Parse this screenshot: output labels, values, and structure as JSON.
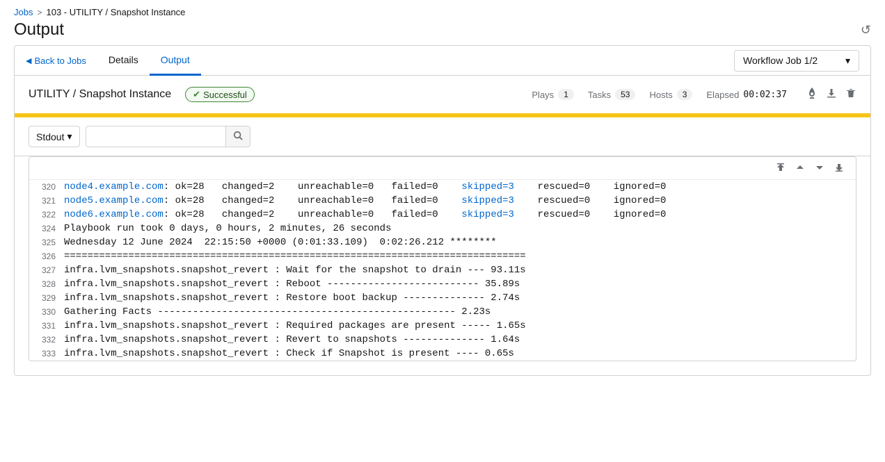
{
  "breadcrumb": {
    "jobs_label": "Jobs",
    "separator": ">",
    "current": "103 - UTILITY / Snapshot Instance"
  },
  "page": {
    "title": "Output",
    "history_icon": "↺"
  },
  "tabs": {
    "back_label": "Back to Jobs",
    "details_label": "Details",
    "output_label": "Output"
  },
  "workflow_select": {
    "label": "Workflow Job 1/2",
    "icon": "▾"
  },
  "job": {
    "name": "UTILITY / Snapshot Instance",
    "status": "Successful",
    "plays_label": "Plays",
    "plays_value": "1",
    "tasks_label": "Tasks",
    "tasks_value": "53",
    "hosts_label": "Hosts",
    "hosts_value": "3",
    "elapsed_label": "Elapsed",
    "elapsed_value": "00:02:37"
  },
  "action_icons": {
    "rocket": "🚀",
    "download": "⬇",
    "trash": "🗑"
  },
  "toolbar": {
    "stdout_label": "Stdout",
    "search_placeholder": "",
    "search_icon": "🔍"
  },
  "scroll_controls": {
    "up_first": "⇑",
    "up": "∧",
    "down": "∨",
    "down_last": "⇓"
  },
  "output_lines": [
    {
      "num": "320",
      "content": "node4.example.com          : ok=28   changed=2    unreachable=0   failed=0    skipped=3    rescued=0    ignored=0",
      "host": true
    },
    {
      "num": "321",
      "content": "node5.example.com          : ok=28   changed=2    unreachable=0   failed=0    skipped=3    rescued=0    ignored=0",
      "host": true
    },
    {
      "num": "322",
      "content": "node6.example.com          : ok=28   changed=2    unreachable=0   failed=0    skipped=3    rescued=0    ignored=0",
      "host": true
    },
    {
      "num": "324",
      "content": "Playbook run took 0 days, 0 hours, 2 minutes, 26 seconds",
      "host": false
    },
    {
      "num": "325",
      "content": "Wednesday 12 June 2024  22:15:50 +0000 (0:01:33.109)  0:02:26.212 ********",
      "host": false
    },
    {
      "num": "326",
      "content": "===============================================================================",
      "host": false
    },
    {
      "num": "327",
      "content": "infra.lvm_snapshots.snapshot_revert : Wait for the snapshot to drain --- 93.11s",
      "host": false
    },
    {
      "num": "328",
      "content": "infra.lvm_snapshots.snapshot_revert : Reboot -------------------------- 35.89s",
      "host": false
    },
    {
      "num": "329",
      "content": "infra.lvm_snapshots.snapshot_revert : Restore boot backup -------------- 2.74s",
      "host": false
    },
    {
      "num": "330",
      "content": "Gathering Facts --------------------------------------------------- 2.23s",
      "host": false
    },
    {
      "num": "331",
      "content": "infra.lvm_snapshots.snapshot_revert : Required packages are present ----- 1.65s",
      "host": false
    },
    {
      "num": "332",
      "content": "infra.lvm_snapshots.snapshot_revert : Revert to snapshots -------------- 1.64s",
      "host": false
    },
    {
      "num": "333",
      "content": "infra.lvm_snapshots.snapshot_revert : Check if Snapshot is present ---- 0.65s",
      "host": false
    }
  ]
}
